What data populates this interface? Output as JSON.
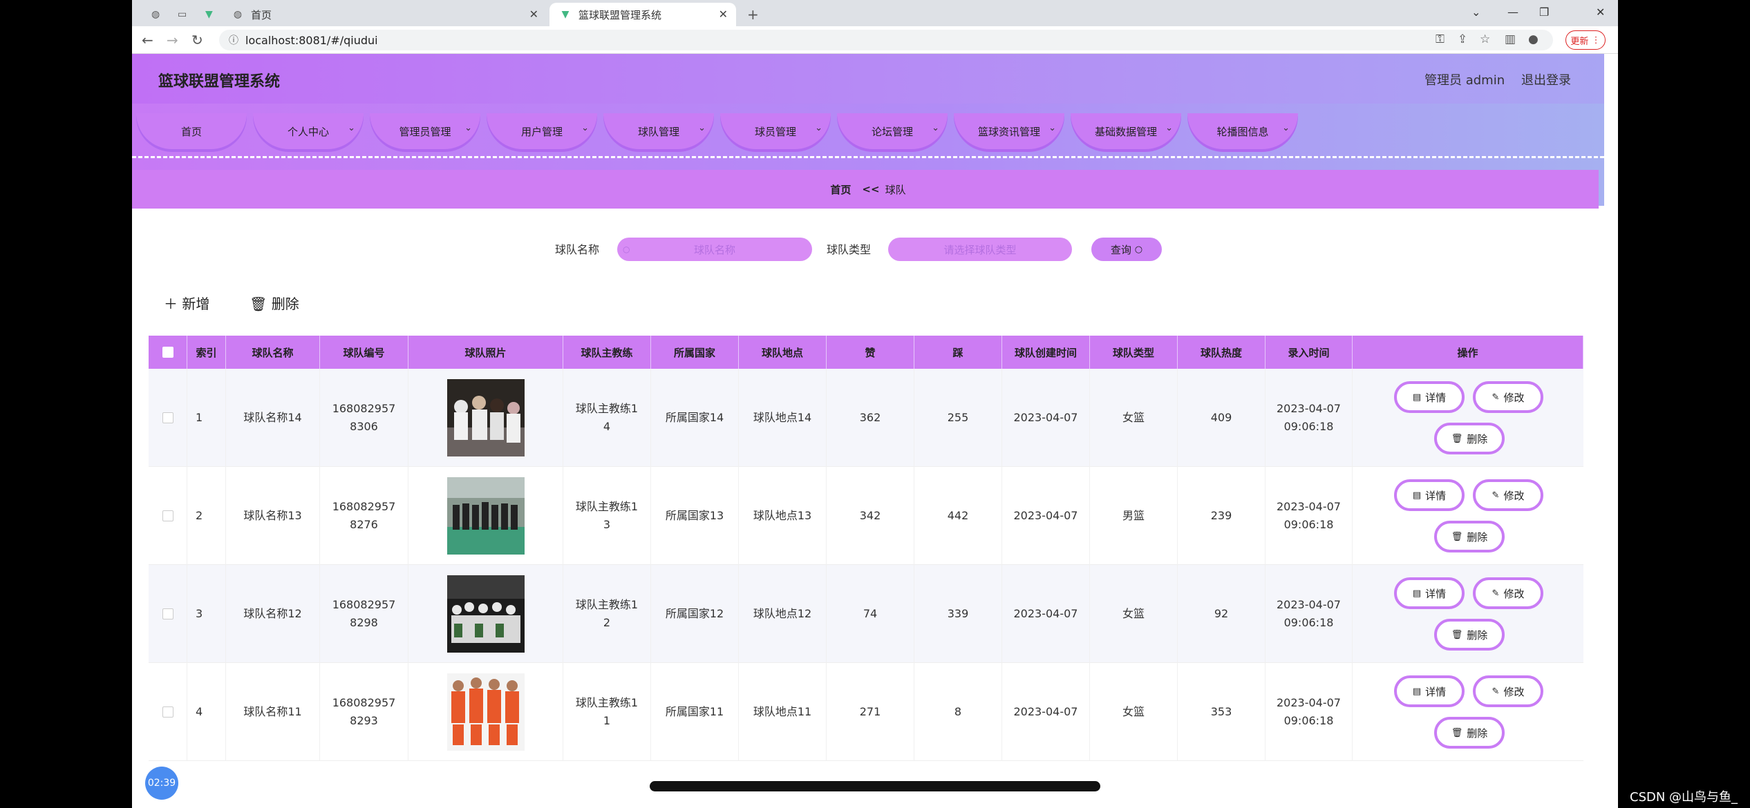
{
  "browser": {
    "tabs": [
      {
        "title": ""
      },
      {
        "title": "首页"
      },
      {
        "title": "篮球联盟管理系统"
      }
    ],
    "url": "localhost:8081/#/qiudui",
    "update_label": "更新"
  },
  "app": {
    "title": "篮球联盟管理系统",
    "user": "管理员 admin",
    "logout": "退出登录",
    "menu": [
      {
        "label": "首页",
        "has_caret": false
      },
      {
        "label": "个人中心",
        "has_caret": true
      },
      {
        "label": "管理员管理",
        "has_caret": true
      },
      {
        "label": "用户管理",
        "has_caret": true
      },
      {
        "label": "球队管理",
        "has_caret": true
      },
      {
        "label": "球员管理",
        "has_caret": true
      },
      {
        "label": "论坛管理",
        "has_caret": true
      },
      {
        "label": "篮球资讯管理",
        "has_caret": true
      },
      {
        "label": "基础数据管理",
        "has_caret": true
      },
      {
        "label": "轮播图信息",
        "has_caret": true
      }
    ],
    "breadcrumb": {
      "home": "首页",
      "sep": "<<",
      "current": "球队"
    }
  },
  "search": {
    "name_label": "球队名称",
    "name_placeholder": "球队名称",
    "type_label": "球队类型",
    "type_placeholder": "请选择球队类型",
    "query_label": "查询"
  },
  "actions": {
    "add": "新增",
    "delete": "删除"
  },
  "table": {
    "columns": [
      "索引",
      "球队名称",
      "球队编号",
      "球队照片",
      "球队主教练",
      "所属国家",
      "球队地点",
      "赞",
      "踩",
      "球队创建时间",
      "球队类型",
      "球队热度",
      "录入时间",
      "操作"
    ],
    "row_buttons": {
      "detail": "详情",
      "edit": "修改",
      "delete": "删除"
    },
    "rows": [
      {
        "index": "1",
        "name": "球队名称14",
        "code": "1680829578306",
        "coach": "球队主教练14",
        "country": "所属国家14",
        "place": "球队地点14",
        "likes": "362",
        "dislikes": "255",
        "created": "2023-04-07",
        "type": "女篮",
        "heat": "409",
        "entered": "2023-04-07 09:06:18"
      },
      {
        "index": "2",
        "name": "球队名称13",
        "code": "1680829578276",
        "coach": "球队主教练13",
        "country": "所属国家13",
        "place": "球队地点13",
        "likes": "342",
        "dislikes": "442",
        "created": "2023-04-07",
        "type": "男篮",
        "heat": "239",
        "entered": "2023-04-07 09:06:18"
      },
      {
        "index": "3",
        "name": "球队名称12",
        "code": "1680829578298",
        "coach": "球队主教练12",
        "country": "所属国家12",
        "place": "球队地点12",
        "likes": "74",
        "dislikes": "339",
        "created": "2023-04-07",
        "type": "女篮",
        "heat": "92",
        "entered": "2023-04-07 09:06:18"
      },
      {
        "index": "4",
        "name": "球队名称11",
        "code": "1680829578293",
        "coach": "球队主教练11",
        "country": "所属国家11",
        "place": "球队地点11",
        "likes": "271",
        "dislikes": "8",
        "created": "2023-04-07",
        "type": "女篮",
        "heat": "353",
        "entered": "2023-04-07 09:06:18"
      }
    ]
  },
  "overlay": {
    "timer": "02:39",
    "watermark": "CSDN @山鸟与鱼_"
  },
  "colors": {
    "accent": "#c97cf5",
    "header_start": "#c070f5",
    "header_end": "#a9a5f3"
  }
}
